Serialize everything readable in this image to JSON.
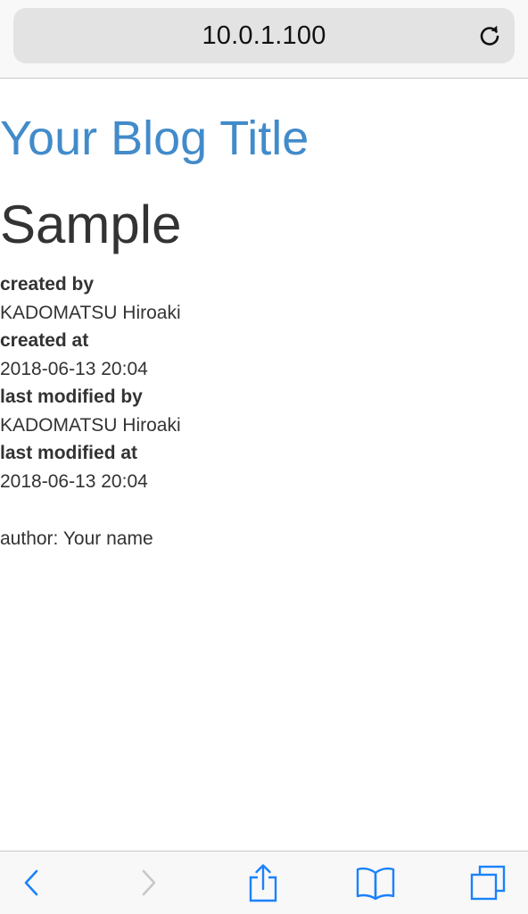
{
  "browser": {
    "url": "10.0.1.100"
  },
  "blog": {
    "title": "Your Blog Title"
  },
  "post": {
    "title": "Sample",
    "meta": [
      {
        "label": "created by",
        "value": "KADOMATSU Hiroaki"
      },
      {
        "label": "created at",
        "value": "2018-06-13 20:04"
      },
      {
        "label": "last modified by",
        "value": "KADOMATSU Hiroaki"
      },
      {
        "label": "last modified at",
        "value": "2018-06-13 20:04"
      }
    ],
    "body": "author: Your name"
  },
  "toolbar": {
    "icons": [
      "back-icon",
      "forward-icon",
      "share-icon",
      "bookmarks-icon",
      "tabs-icon"
    ]
  },
  "colors": {
    "accent": "#428bca",
    "toolbar_icon": "#1a82fb",
    "toolbar_icon_disabled": "#c7c7cc",
    "text": "#333333"
  }
}
